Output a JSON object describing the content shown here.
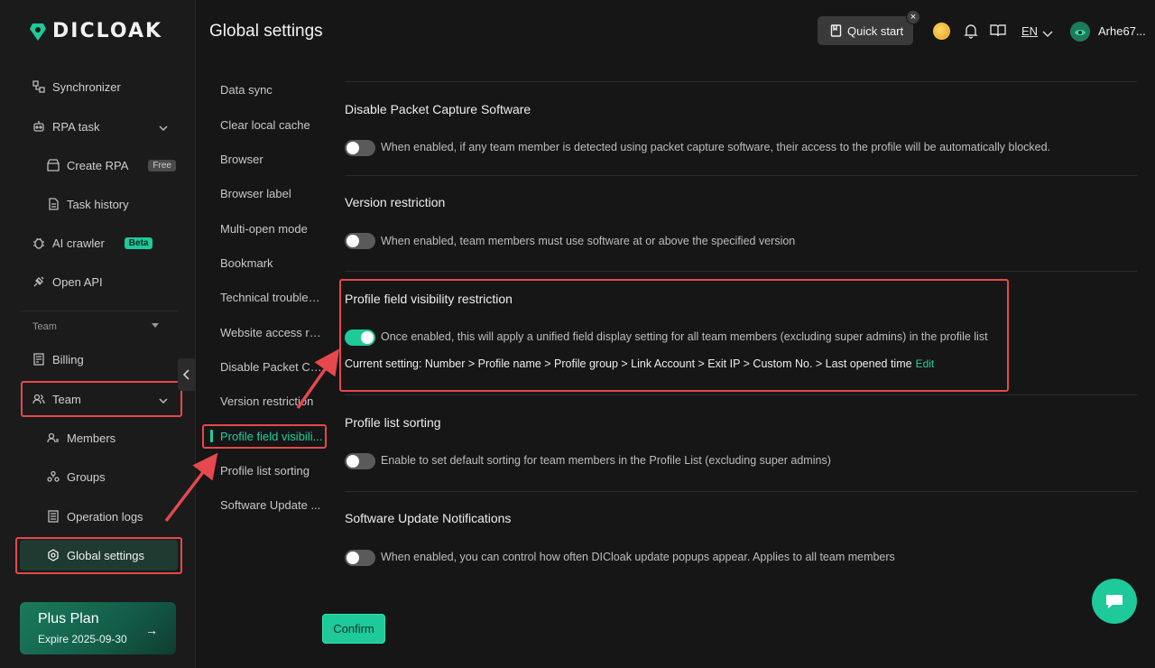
{
  "app": {
    "logo_text": "DICLOAK"
  },
  "header": {
    "title": "Global settings",
    "quick_start": "Quick start",
    "close_glyph": "×",
    "language": "EN",
    "username": "Arhe67..."
  },
  "sidebar": {
    "items": [
      {
        "label": "Synchronizer"
      },
      {
        "label": "RPA task"
      },
      {
        "label": "Create RPA",
        "badge": "Free"
      },
      {
        "label": "Task history"
      },
      {
        "label": "AI crawler",
        "badge": "Beta"
      },
      {
        "label": "Open API"
      },
      {
        "label": "Billing"
      },
      {
        "label": "Team"
      },
      {
        "label": "Members"
      },
      {
        "label": "Groups"
      },
      {
        "label": "Operation logs"
      },
      {
        "label": "Global settings"
      }
    ],
    "team_section": "Team",
    "plan": {
      "title": "Plus Plan",
      "expire": "Expire 2025-09-30",
      "arrow": "→"
    }
  },
  "subnav": {
    "items": [
      "Data sync",
      "Clear local cache",
      "Browser",
      "Browser label",
      "Multi-open mode",
      "Bookmark",
      "Technical troubles...",
      "Website access re...",
      "Disable Packet Ca...",
      "Version restriction",
      "Profile field visibili...",
      "Profile list sorting",
      "Software Update ..."
    ],
    "active_index": 10
  },
  "sections": [
    {
      "title": "Disable Packet Capture Software",
      "desc": "When enabled, if any team member is detected using packet capture software, their access to the profile will be automatically blocked.",
      "enabled": false
    },
    {
      "title": "Version restriction",
      "desc": "When enabled, team members must use software at or above the specified version",
      "enabled": false
    },
    {
      "title": "Profile field visibility restriction",
      "desc": "Once enabled, this will apply a unified field display setting for all team members (excluding super admins) in the profile list",
      "enabled": true,
      "current_setting": "Current setting: Number > Profile name > Profile group > Link Account > Exit IP > Custom No. > Last opened time",
      "edit": "Edit"
    },
    {
      "title": "Profile list sorting",
      "desc": "Enable to set default sorting for team members in the Profile List (excluding super admins)",
      "enabled": false
    },
    {
      "title": "Software Update Notifications",
      "desc": "When enabled, you can control how often DICloak update popups appear. Applies to all team members",
      "enabled": false
    }
  ],
  "confirm": "Confirm",
  "colors": {
    "accent": "#1ec99a",
    "highlight": "#e5484d",
    "background": "#161616"
  }
}
